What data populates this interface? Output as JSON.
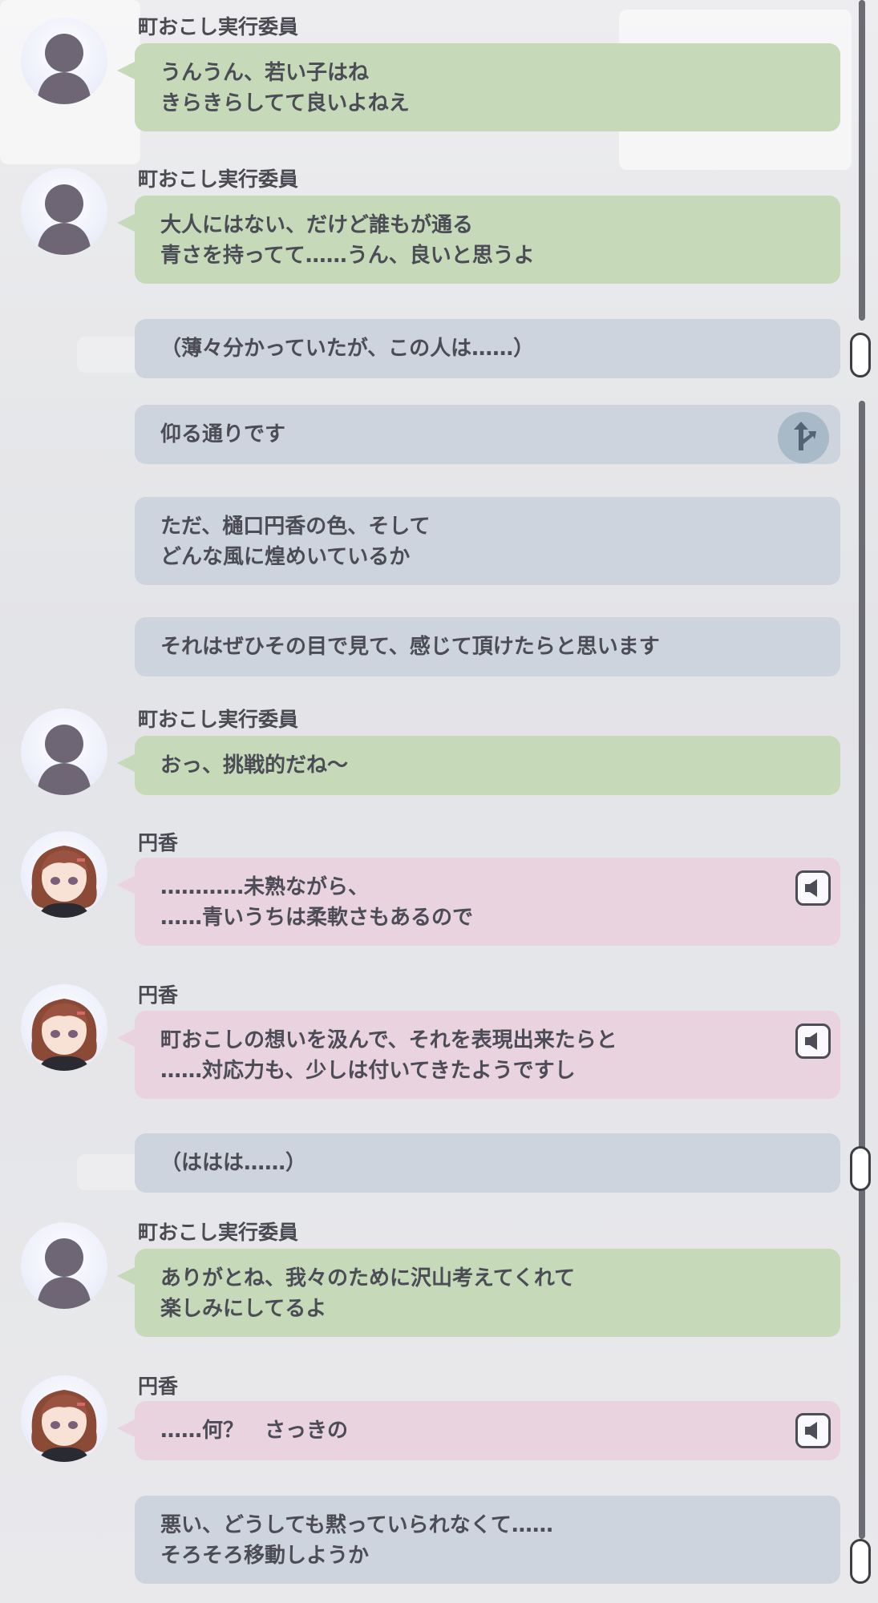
{
  "names": {
    "committee": "町おこし実行委員",
    "madoka": "円香"
  },
  "messages": [
    {
      "speaker": "町おこし実行委員",
      "lines": [
        "うんうん、若い子はね",
        "きらきらしてて良いよねえ"
      ]
    },
    {
      "speaker": "町おこし実行委員",
      "lines": [
        "大人にはない、だけど誰もが通る",
        "青さを持ってて……うん、良いと思うよ"
      ]
    },
    {
      "lines": [
        "（薄々分かっていたが、この人は……）"
      ]
    },
    {
      "lines": [
        "仰る通りです"
      ],
      "icon": "branch-choice-icon"
    },
    {
      "lines": [
        "ただ、樋口円香の色、そして",
        "どんな風に煌めいているか"
      ]
    },
    {
      "lines": [
        "それはぜひその目で見て、感じて頂けたらと思います"
      ]
    },
    {
      "speaker": "町おこし実行委員",
      "lines": [
        "おっ、挑戦的だね〜"
      ]
    },
    {
      "speaker": "円香",
      "lines": [
        "…………未熟ながら、",
        "……青いうちは柔軟さもあるので"
      ],
      "icon": "voice-play-icon"
    },
    {
      "speaker": "円香",
      "lines": [
        "町おこしの想いを汲んで、それを表現出来たらと",
        "……対応力も、少しは付いてきたようですし"
      ],
      "icon": "voice-play-icon"
    },
    {
      "lines": [
        "（ははは……）"
      ]
    },
    {
      "speaker": "町おこし実行委員",
      "lines": [
        "ありがとね、我々のために沢山考えてくれて",
        "楽しみにしてるよ"
      ]
    },
    {
      "speaker": "円香",
      "lines": [
        "……何？　さっきの"
      ],
      "icon": "voice-play-icon"
    },
    {
      "lines": [
        "悪い、どうしても黙っていられなくて……",
        "そろそろ移動しようか"
      ]
    }
  ],
  "colors": {
    "committee_bubble": "#c6d9b8",
    "madoka_bubble": "#e8d3df",
    "producer_bubble": "#cdd4dd",
    "text": "#4b4c56"
  }
}
